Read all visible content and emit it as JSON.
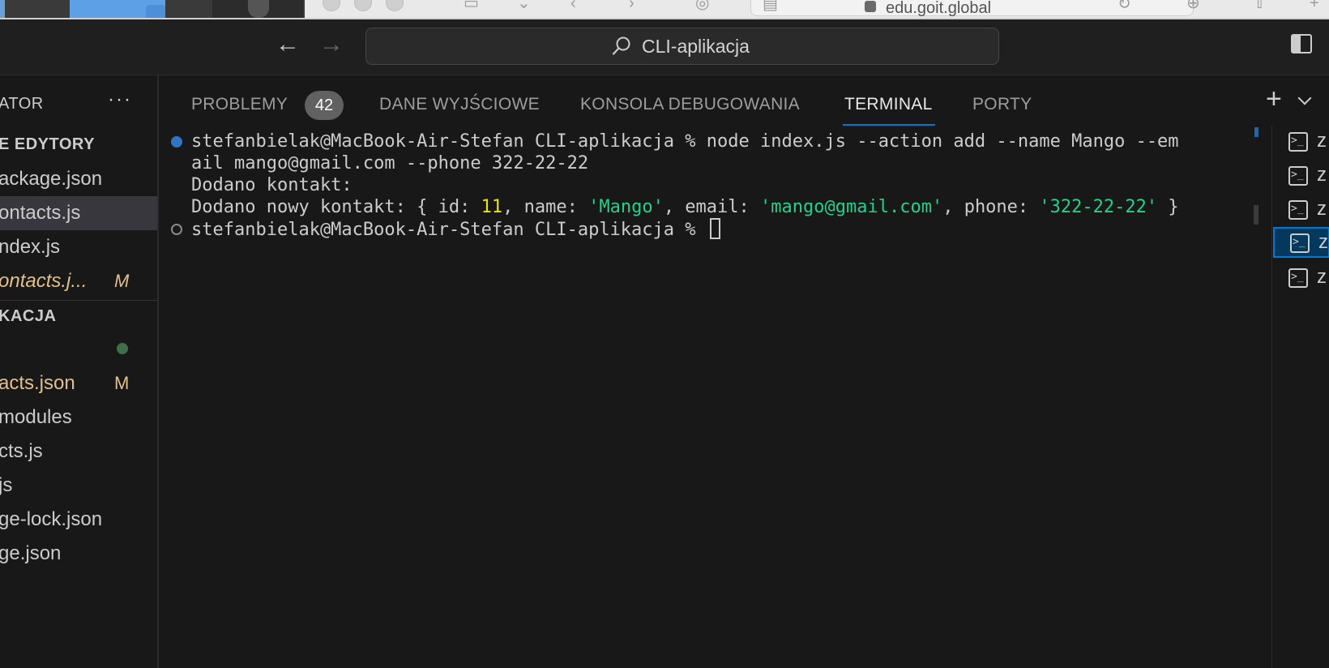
{
  "browser": {
    "url": "edu.goit.global"
  },
  "titlebar": {
    "command_center": "CLI-aplikacja"
  },
  "sidebar": {
    "header": "ATOR",
    "more": "···",
    "open_editors_title": "E EDYTORY",
    "open_editors": [
      {
        "label": "ackage.json"
      },
      {
        "label": "ontacts.js"
      },
      {
        "label": "ndex.js"
      },
      {
        "label": "ontacts.j...",
        "badge": "M"
      }
    ],
    "project_title": "KACJA",
    "files": [
      {
        "label": "acts.json",
        "badge": "M"
      },
      {
        "label": "modules"
      },
      {
        "label": "cts.js"
      },
      {
        "label": "js"
      },
      {
        "label": "ge-lock.json"
      },
      {
        "label": "ge.json"
      }
    ]
  },
  "panel": {
    "tabs": [
      "PROBLEMY",
      "DANE WYJŚCIOWE",
      "KONSOLA DEBUGOWANIA",
      "TERMINAL",
      "PORTY"
    ],
    "problems_count": "42",
    "active_tab": "TERMINAL",
    "terminal": {
      "line1": "stefanbielak@MacBook-Air-Stefan CLI-aplikacja % node index.js --action add --name Mango --em",
      "line2": "ail mango@gmail.com --phone 322-22-22",
      "line3": "Dodano kontakt:",
      "line4_prefix": "Dodano nowy kontakt: { id: ",
      "line4_id": "11",
      "line4_mid1": ", name: ",
      "line4_name": "'Mango'",
      "line4_mid2": ", email: ",
      "line4_email": "'mango@gmail.com'",
      "line4_mid3": ", phone: ",
      "line4_phone": "'322-22-22'",
      "line4_suffix": " }",
      "prompt": "stefanbielak@MacBook-Air-Stefan CLI-aplikacja % "
    },
    "terminal_list": [
      {
        "label": "z"
      },
      {
        "label": "z"
      },
      {
        "label": "z"
      },
      {
        "label": "z",
        "active": true
      },
      {
        "label": "z"
      }
    ]
  },
  "colors": {
    "accent": "#0078d4",
    "number": "#e5e510",
    "string": "#23d18b",
    "modified": "#e2c08d"
  }
}
